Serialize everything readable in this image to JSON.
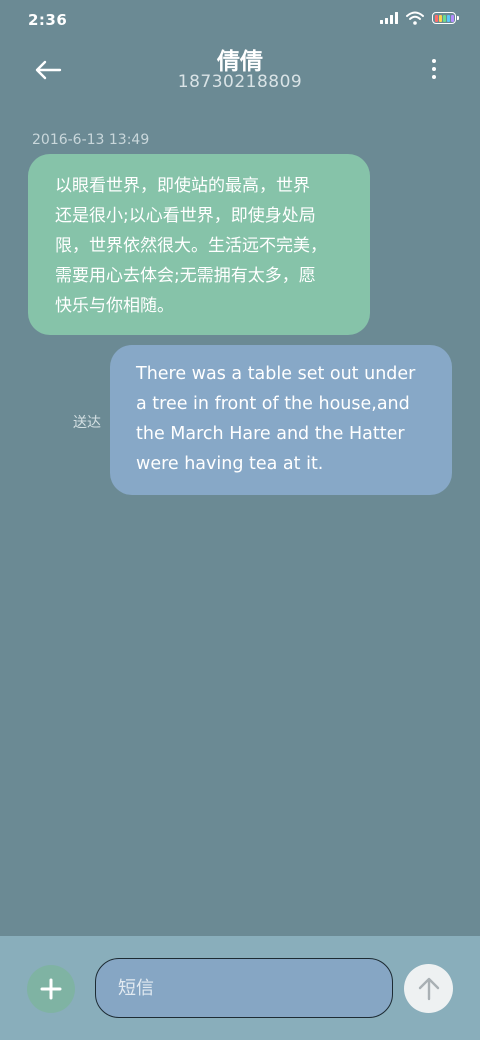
{
  "status_bar": {
    "time": "2:36",
    "icons": [
      "signal-icon",
      "wifi-icon",
      "battery-icon"
    ]
  },
  "header": {
    "contact_name": "倩倩",
    "contact_number": "18730218809",
    "back_icon": "arrow-left-icon",
    "menu_icon": "more-vertical-icon"
  },
  "conversation": {
    "timestamp": "2016-6-13 13:49",
    "messages": [
      {
        "direction": "received",
        "text": "以眼看世界，即使站的最高，世界\n还是很小;以心看世界，即使身处局\n限，世界依然很大。生活远不完美，\n需要用心去体会;无需拥有太多，愿\n快乐与你相随。"
      },
      {
        "direction": "sent",
        "status": "送达",
        "text": "There was a table set out under\na tree in front of the house,and\nthe March Hare and the Hatter\nwere having tea at it."
      }
    ]
  },
  "compose": {
    "placeholder": "短信",
    "value": "",
    "add_icon": "plus-icon",
    "send_icon": "arrow-up-icon"
  },
  "colors": {
    "background": "#6b8a94",
    "received_bubble": "#86c3a9",
    "sent_bubble": "#87a8c7",
    "compose_bar": "#89aebb",
    "add_button": "#7fb3a3",
    "send_button": "#eef1f2"
  }
}
